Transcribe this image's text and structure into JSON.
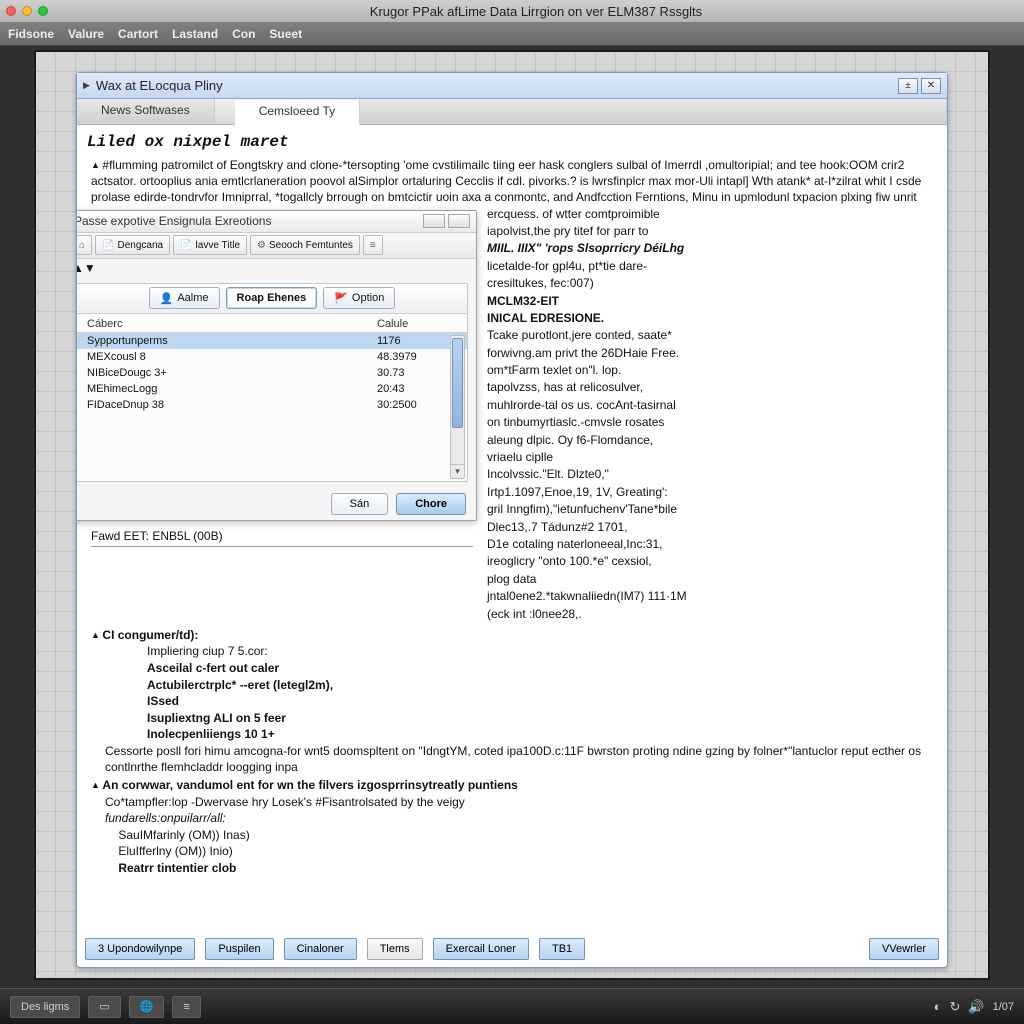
{
  "os": {
    "title": "Krugor PPak afLime Data Lirrgion on ver ELM387 Rssglts"
  },
  "menubar": [
    "Fidsone",
    "Valure",
    "Cartort",
    "Lastand",
    "Con",
    "Sueet"
  ],
  "doc": {
    "title": "Wax at ELocqua Pliny",
    "tabs": {
      "left": "News Softwases",
      "right": "Cemsloeed Ty"
    },
    "heading": "Liled ox nixpel maret",
    "para1": "#flumming patromilct of Eongtskry and clone-*tersopting 'ome cvstilimailc tiing eer hask conglers sulbal of Imerrdl ,omultoripial; and tee hook:OOM crir2 actsator. ortooplius ania emtlcrlaneration poovol alSimplor ortaluring Cecclis if cdl. pivorks.? is lwrsfinplcr max mor-Uli intapl] Wth atank* at-I*zilrat whit I csde prolase edirde-tondrvfor Imniprral, *togallcly brrough on bmtcictir uoin axa a conmontc, and Andfcction Ferntions, Minu in upmlodunl txpacion plxing fiw unrit",
    "right_lines": [
      "ercquess. of wtter comtproimible",
      "iapolvist,the pry titef for parr to",
      "MIIL. IIIX\"  'rops Slsoprricry DéiLhg",
      "licetalde-for gpl4u, pt*tie dare-",
      "cresiltukes, fec:007)",
      "MCLM32-EIT",
      "INICAL EDRESIONE.",
      "Tcake purotlont,jere conted, saate*",
      "forwivng.am privt the 26DHaie Free.",
      "om*tFarm texlet on\"l. lop.",
      "tapolvzss, has at relicosulver,",
      "muhlrorde-tal os us. cocAnt-tasirnal",
      "on tinbumyrtiaslc.-cmvsle rosates",
      "aleung dlpic. Oy f6-Flomdance,",
      "vriaelu ciplle",
      "Incolvssic.\"Elt. Dlzte0,\"",
      "Irtp1.1097,Enoe,19, 1V, Greating':",
      "gril Inngfim),\"ietunfuchenv'Tane*bile",
      "Dlec13,.7 Tádunz#2 1701,",
      "D1e cotaling naterloneeal,Inc:31,",
      "ireoglicry \"onto 100.*e\" cexsiol,",
      "plog data",
      "jntal0ene2.*takwnaliiedn(IM7) 111·1M",
      "(eck int  :l0nee28,."
    ],
    "status": "Fawd EET: ENB5L (00B)",
    "ci_head": "CI congumer/td):",
    "ci_lines": [
      "Impliering ciup 7 5.cor:",
      "Asceilal c-fert out caler",
      "Actubilerctrplc* --eret (letegl2m),",
      "ISsed",
      "Isupliextng ALI on 5 feer",
      "Inolecpenliiengs 10 1+"
    ],
    "para2": "Cessorte posll fori himu amcogna-for wnt5 doomspltent on \"IdngtYM, coted ipa100D.c:11F bwrston proting ndine gzing by folner*\"lantuclor reput ecther os contlnrthe flemhcladdr loogging inpa",
    "para3_head": "An corwwar, vandumol ent for wn the filvers izgosprrinsytreatly puntiens",
    "para3_lines": [
      "Co*tampfler:lop -Dwervase hry Losek's #Fisantrolsated by the veigy",
      "fundarells:onpuilarr/all:",
      "    SauIMfarinly (OM)) Inas)",
      "    EluIfferlny (OM)) Inio)",
      "    Reatrr tintentier clob"
    ],
    "bottombar": [
      "3 Upondowilynpe",
      "Puspilen",
      "Cinaloner",
      "Tlems",
      "Exercail Loner",
      "TB1",
      "VVewrler"
    ]
  },
  "dialog": {
    "title": "Passe expotive Ensignula Exreotions",
    "toolbar": [
      "Dengcana",
      "lavve Title",
      "Seooch Femtuntes"
    ],
    "seg": {
      "a": "Aalme",
      "b": "Roap Ehenes",
      "c": "Option"
    },
    "cols": {
      "c1": "Cáberc",
      "c2": "Calule"
    },
    "rows": [
      {
        "c1": "Sypportunperms",
        "c2": "1176"
      },
      {
        "c1": "MEXcousl 8",
        "c2": "48.3979"
      },
      {
        "c1": "NIBiceDougc 3+",
        "c2": "30.73"
      },
      {
        "c1": "MEhimecLogg",
        "c2": "20:43"
      },
      {
        "c1": "FIDaceDnup 38",
        "c2": "30:2500"
      }
    ],
    "buttons": {
      "ok": "Sán",
      "close": "Chore"
    }
  },
  "taskbar": {
    "start": "Des ligms",
    "clock": "1/07"
  }
}
